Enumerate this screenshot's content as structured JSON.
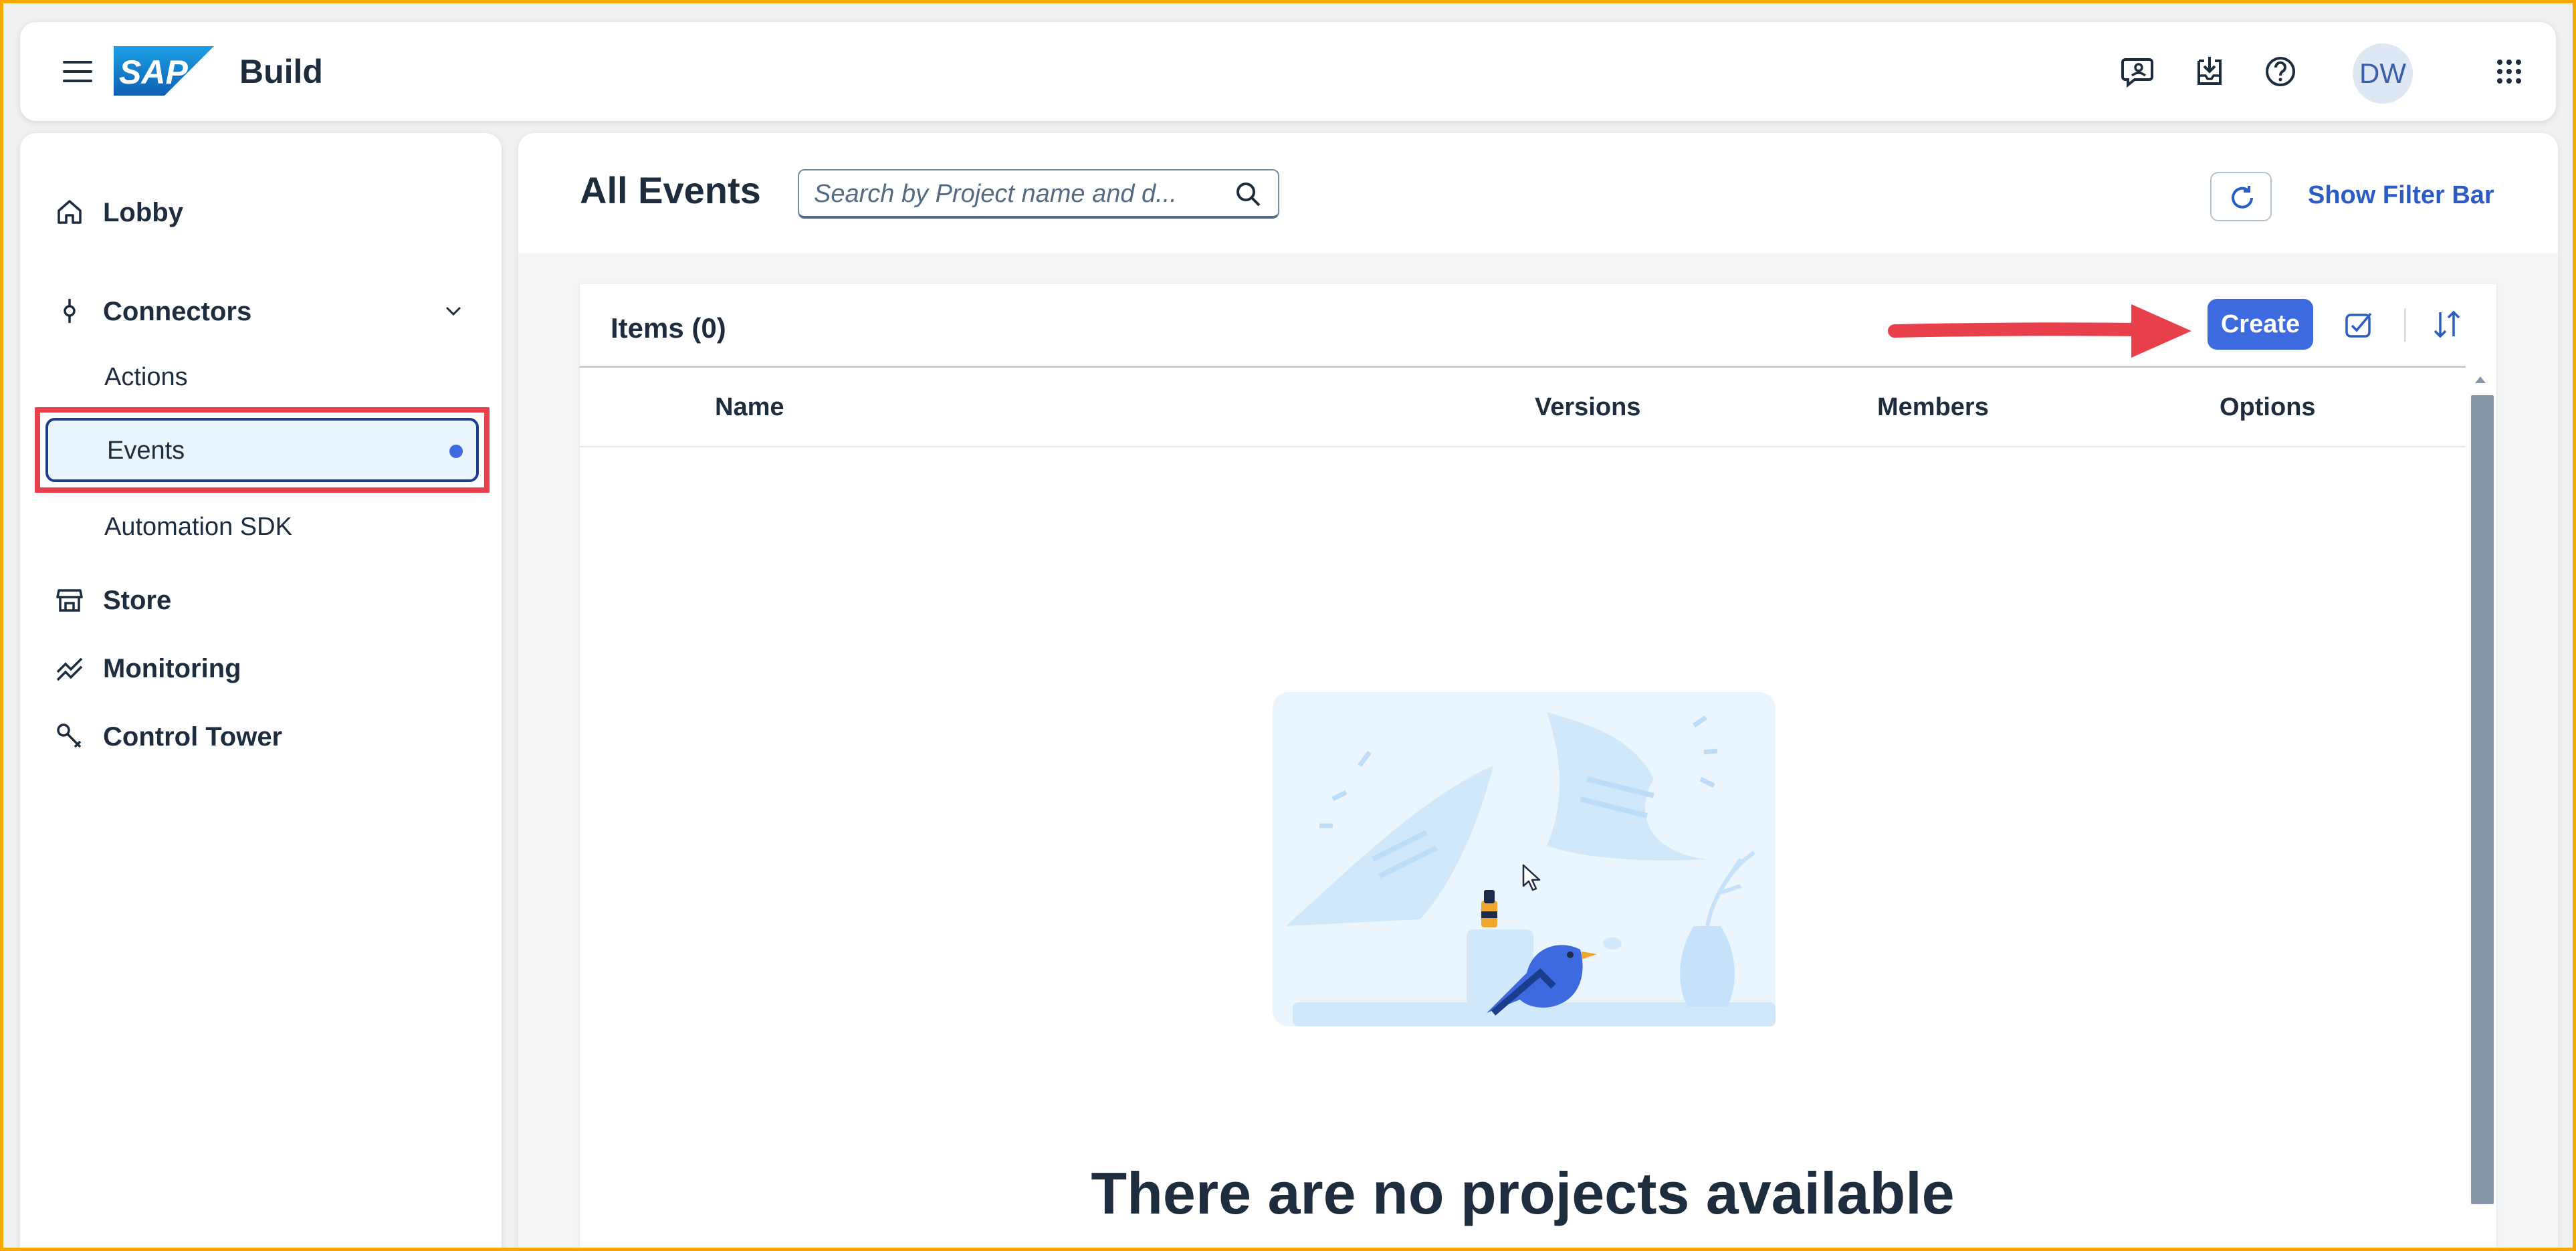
{
  "shellbar": {
    "brand": "Build",
    "logo_text": "SAP",
    "avatar_initials": "DW",
    "icons": [
      "menu-icon",
      "feedback-icon",
      "notifications-inbox-icon",
      "help-icon",
      "product-switch-icon"
    ]
  },
  "sidebar": {
    "items": [
      {
        "label": "Lobby",
        "icon": "home-icon"
      },
      {
        "label": "Connectors",
        "icon": "connector-icon",
        "expanded": true
      },
      {
        "label": "Actions"
      },
      {
        "label": "Events",
        "selected": true
      },
      {
        "label": "Automation SDK"
      },
      {
        "label": "Store",
        "icon": "store-icon"
      },
      {
        "label": "Monitoring",
        "icon": "monitoring-icon"
      },
      {
        "label": "Control Tower",
        "icon": "wrench-icon"
      }
    ]
  },
  "main": {
    "title": "All Events",
    "search_placeholder": "Search by Project name and d...",
    "filter_bar_link": "Show Filter Bar",
    "table": {
      "items_title": "Items (0)",
      "create_label": "Create",
      "columns": [
        "Name",
        "Versions",
        "Members",
        "Options"
      ],
      "rows": []
    },
    "empty_state_title": "There are no projects available"
  },
  "colors": {
    "accent": "#3e6ae0",
    "annotation_red": "#e8404a",
    "link": "#2a5cc4",
    "text": "#1d2d3e"
  }
}
